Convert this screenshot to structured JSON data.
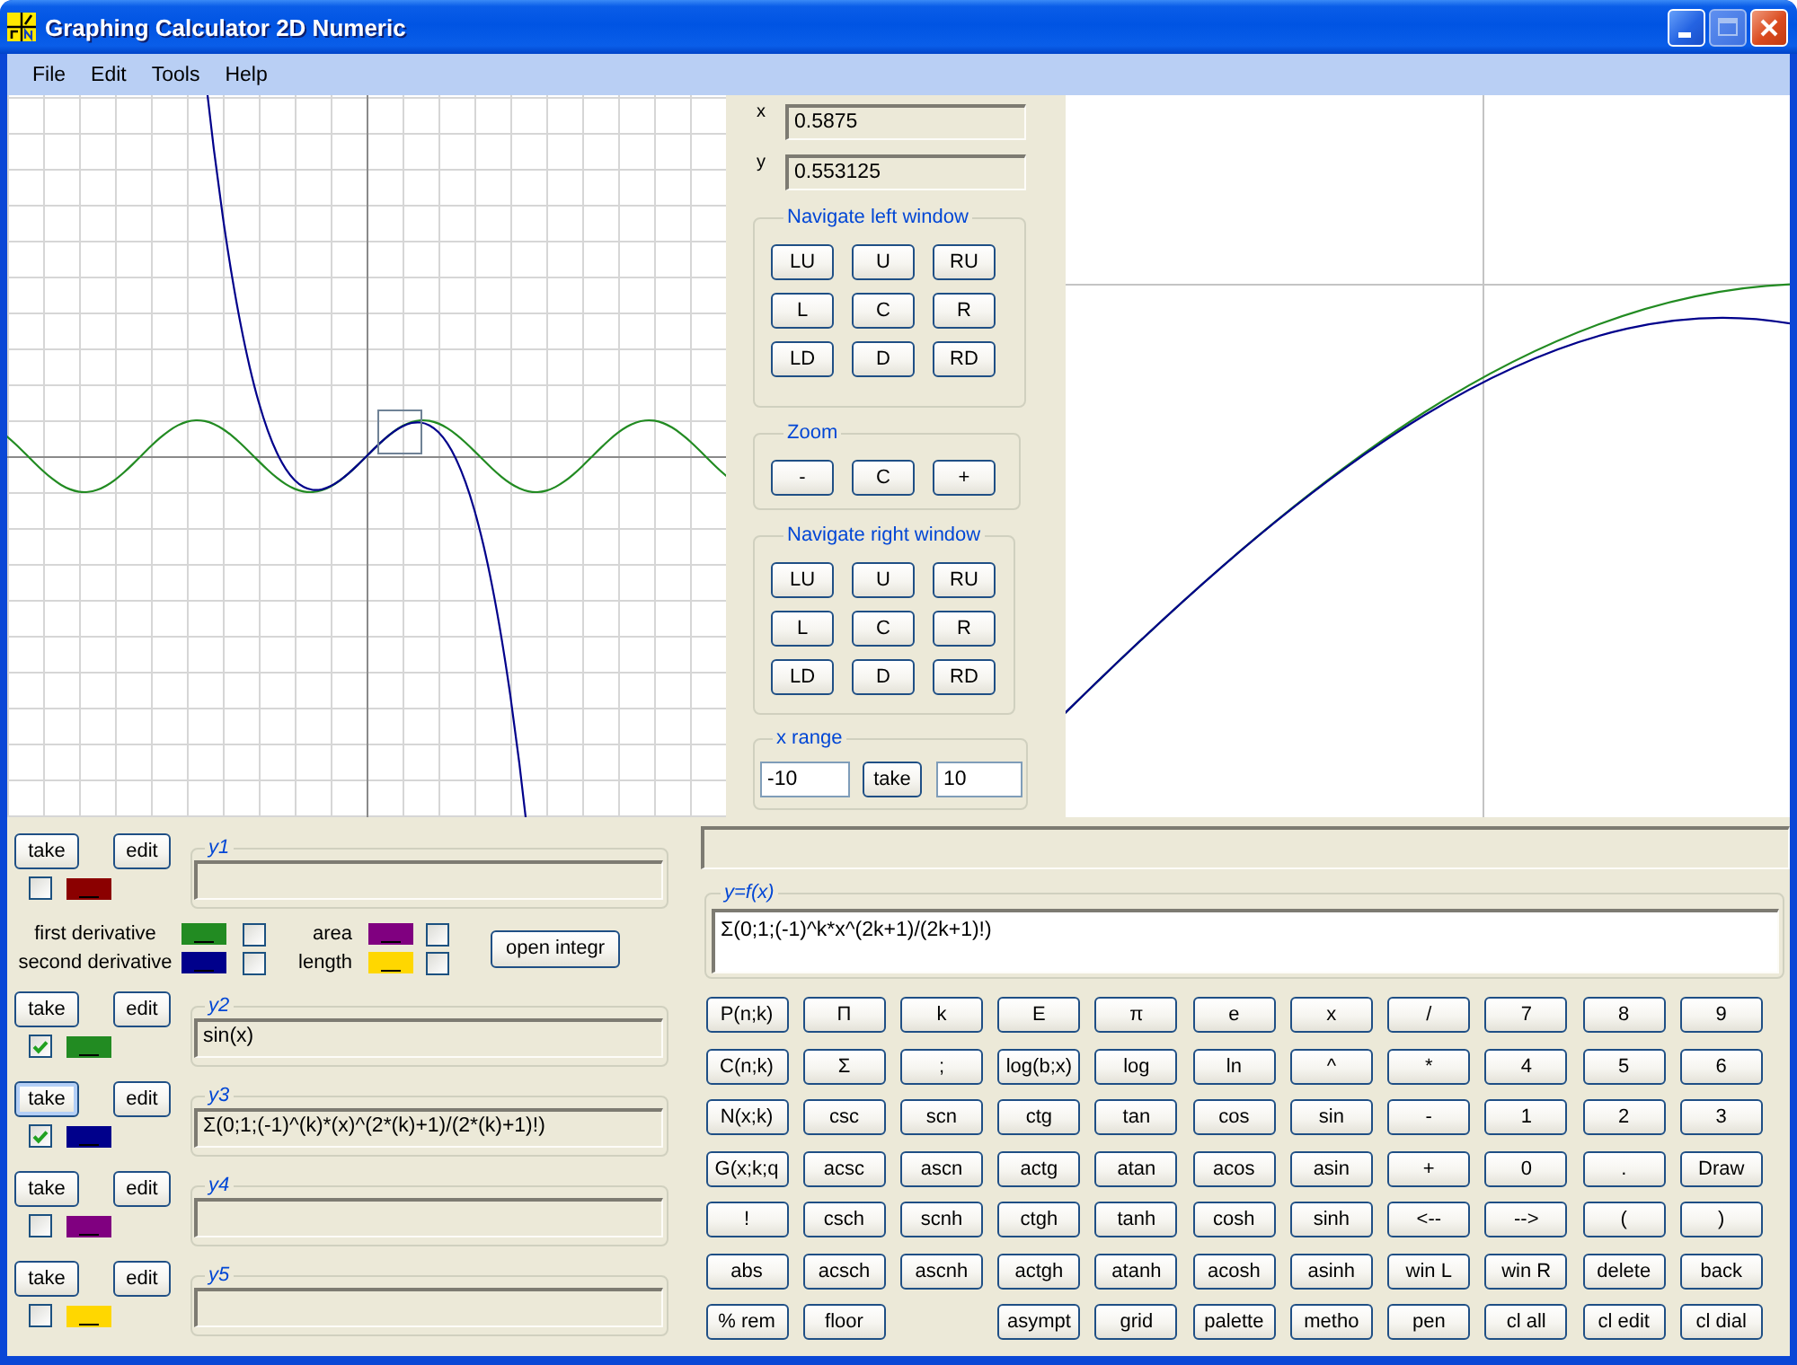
{
  "window": {
    "title": "Graphing Calculator 2D Numeric",
    "controls": [
      {
        "kind": "minimize",
        "disabled": false
      },
      {
        "kind": "maximize",
        "disabled": true
      },
      {
        "kind": "close",
        "disabled": false
      }
    ]
  },
  "menu": [
    "File",
    "Edit",
    "Tools",
    "Help"
  ],
  "coordinates": [
    {
      "label": "x",
      "value": "0.5875"
    },
    {
      "label": "y",
      "value": "0.553125"
    }
  ],
  "navigate_left": {
    "title": "Navigate left window",
    "buttons": [
      "LU",
      "U",
      "RU",
      "L",
      "C",
      "R",
      "LD",
      "D",
      "RD"
    ]
  },
  "zoom": {
    "title": "Zoom",
    "buttons": [
      "-",
      "C",
      "+"
    ]
  },
  "navigate_right": {
    "title": "Navigate right window",
    "buttons": [
      "LU",
      "U",
      "RU",
      "L",
      "C",
      "R",
      "LD",
      "D",
      "RD"
    ]
  },
  "x_range": {
    "title": "x range",
    "from": "-10",
    "button": "take",
    "to": "10"
  },
  "functions": [
    {
      "name": "y1",
      "take_button": "take",
      "edit_button": "edit",
      "take_focused": false,
      "checked": false,
      "color": "#8b0000"
    },
    {
      "name": "y2",
      "take_button": "take",
      "edit_button": "edit",
      "take_focused": false,
      "checked": true,
      "color": "#228b22",
      "value": "sin(x)"
    },
    {
      "name": "y3",
      "take_button": "take",
      "edit_button": "edit",
      "take_focused": true,
      "checked": true,
      "color": "#00008b",
      "value": "Σ(0;1;(-1)^(k)*(x)^(2*(k)+1)/(2*(k)+1)!)"
    },
    {
      "name": "y4",
      "take_button": "take",
      "edit_button": "edit",
      "take_focused": false,
      "checked": false,
      "color": "#800080"
    },
    {
      "name": "y5",
      "take_button": "take",
      "edit_button": "edit",
      "take_focused": false,
      "checked": false,
      "color": "#ffd700"
    }
  ],
  "derivatives": [
    {
      "label": "first derivative",
      "color": "#228b22",
      "checked": false
    },
    {
      "label": "second derivative",
      "color": "#00008b",
      "checked": false
    }
  ],
  "integrals": [
    {
      "label": "area",
      "color": "#800080",
      "checked": false
    },
    {
      "label": "length",
      "color": "#ffd700",
      "checked": false
    }
  ],
  "integral_button": "open integr",
  "formula": {
    "label": "y=f(x)",
    "value": "Σ(0;1;(-1)^k*x^(2k+1)/(2k+1)!)"
  },
  "keypad": {
    "rows": [
      [
        {
          "kind": "key",
          "label": "P(n;k)"
        },
        {
          "kind": "key",
          "label": "Π"
        },
        {
          "kind": "key",
          "label": "k"
        },
        {
          "kind": "key",
          "label": "E"
        },
        {
          "kind": "key",
          "label": "π"
        },
        {
          "kind": "key",
          "label": "e"
        },
        {
          "kind": "key",
          "label": "x"
        },
        {
          "kind": "key",
          "label": "/"
        },
        {
          "kind": "key",
          "label": "7"
        },
        {
          "kind": "key",
          "label": "8"
        },
        {
          "kind": "key",
          "label": "9"
        }
      ],
      [
        {
          "kind": "key",
          "label": "C(n;k)"
        },
        {
          "kind": "key",
          "label": "Σ"
        },
        {
          "kind": "key",
          "label": ";"
        },
        {
          "kind": "key",
          "label": "log(b;x)"
        },
        {
          "kind": "key",
          "label": "log"
        },
        {
          "kind": "key",
          "label": "ln"
        },
        {
          "kind": "key",
          "label": "^"
        },
        {
          "kind": "key",
          "label": "*"
        },
        {
          "kind": "key",
          "label": "4"
        },
        {
          "kind": "key",
          "label": "5"
        },
        {
          "kind": "key",
          "label": "6"
        }
      ],
      [
        {
          "kind": "key",
          "label": "N(x;k)"
        },
        {
          "kind": "key",
          "label": "csc"
        },
        {
          "kind": "key",
          "label": "scn"
        },
        {
          "kind": "key",
          "label": "ctg"
        },
        {
          "kind": "key",
          "label": "tan"
        },
        {
          "kind": "key",
          "label": "cos"
        },
        {
          "kind": "key",
          "label": "sin"
        },
        {
          "kind": "key",
          "label": "-"
        },
        {
          "kind": "key",
          "label": "1"
        },
        {
          "kind": "key",
          "label": "2"
        },
        {
          "kind": "key",
          "label": "3"
        }
      ],
      [
        {
          "kind": "key",
          "label": "G(x;k;q"
        },
        {
          "kind": "key",
          "label": "acsc"
        },
        {
          "kind": "key",
          "label": "ascn"
        },
        {
          "kind": "key",
          "label": "actg"
        },
        {
          "kind": "key",
          "label": "atan"
        },
        {
          "kind": "key",
          "label": "acos"
        },
        {
          "kind": "key",
          "label": "asin"
        },
        {
          "kind": "key",
          "label": "+"
        },
        {
          "kind": "key",
          "label": "0"
        },
        {
          "kind": "key",
          "label": "."
        },
        {
          "kind": "key",
          "label": "Draw"
        }
      ],
      [
        {
          "kind": "key",
          "label": "!"
        },
        {
          "kind": "key",
          "label": "csch"
        },
        {
          "kind": "key",
          "label": "scnh"
        },
        {
          "kind": "key",
          "label": "ctgh"
        },
        {
          "kind": "key",
          "label": "tanh"
        },
        {
          "kind": "key",
          "label": "cosh"
        },
        {
          "kind": "key",
          "label": "sinh"
        },
        {
          "kind": "key",
          "label": "<--"
        },
        {
          "kind": "key",
          "label": "-->"
        },
        {
          "kind": "key",
          "label": "("
        },
        {
          "kind": "key",
          "label": ")"
        }
      ],
      [
        {
          "kind": "key",
          "label": "abs"
        },
        {
          "kind": "key",
          "label": "acsch"
        },
        {
          "kind": "key",
          "label": "ascnh"
        },
        {
          "kind": "key",
          "label": "actgh"
        },
        {
          "kind": "key",
          "label": "atanh"
        },
        {
          "kind": "key",
          "label": "acosh"
        },
        {
          "kind": "key",
          "label": "asinh"
        },
        {
          "kind": "key",
          "label": "win L"
        },
        {
          "kind": "key",
          "label": "win R"
        },
        {
          "kind": "key",
          "label": "delete"
        },
        {
          "kind": "key",
          "label": "back"
        }
      ],
      [
        {
          "kind": "key",
          "label": "% rem"
        },
        {
          "kind": "key",
          "label": "floor"
        },
        {
          "kind": "gap"
        },
        {
          "kind": "key",
          "label": "asympt"
        },
        {
          "kind": "key",
          "label": "grid"
        },
        {
          "kind": "key",
          "label": "palette"
        },
        {
          "kind": "key",
          "label": "metho"
        },
        {
          "kind": "key",
          "label": "pen"
        },
        {
          "kind": "key",
          "label": "cl all"
        },
        {
          "kind": "key",
          "label": "cl edit"
        },
        {
          "kind": "key",
          "label": "cl dial"
        }
      ]
    ]
  }
}
